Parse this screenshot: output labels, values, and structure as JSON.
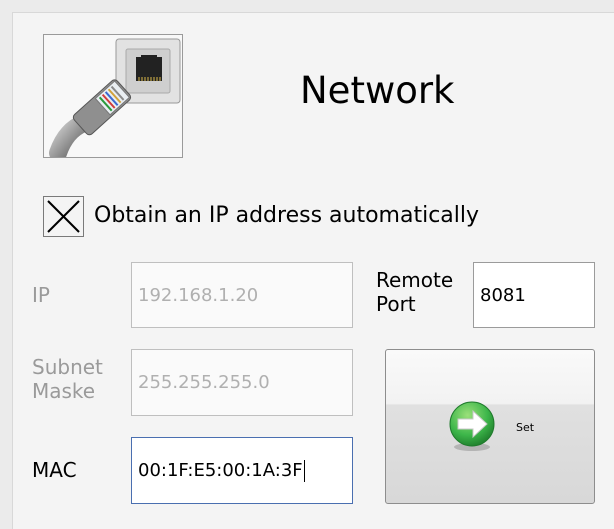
{
  "header": {
    "title": "Network"
  },
  "dhcp": {
    "label": "Obtain an IP address automatically",
    "checked": true
  },
  "fields": {
    "ip": {
      "label": "IP",
      "value": "192.168.1.20",
      "enabled": false
    },
    "subnet": {
      "label_line1": "Subnet",
      "label_line2": "Maske",
      "value": "255.255.255.0",
      "enabled": false
    },
    "mac": {
      "label": "MAC",
      "value": "00:1F:E5:00:1A:3F",
      "enabled": true
    },
    "remote_port": {
      "label_line1": "Remote",
      "label_line2": "Port",
      "value": "8081",
      "enabled": true
    }
  },
  "set_button": {
    "label": "Set",
    "icon": "right-arrow-icon"
  },
  "colors": {
    "disabled_text": "#9a9a9a",
    "focus_border": "#4a6fb0",
    "arrow_green": "#3db64a"
  }
}
